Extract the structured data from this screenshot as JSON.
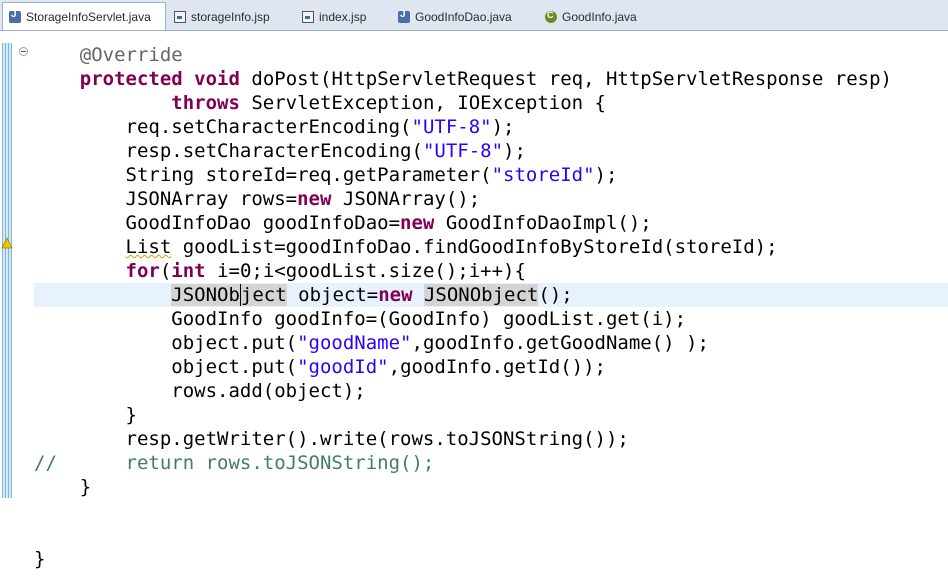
{
  "tabs": [
    {
      "label": "StorageInfoServlet.java",
      "active": true,
      "icon": "java-file-icon"
    },
    {
      "label": "storageInfo.jsp",
      "active": false,
      "icon": "jsp-file-icon"
    },
    {
      "label": "index.jsp",
      "active": false,
      "icon": "jsp-file-icon"
    },
    {
      "label": "GoodInfoDao.java",
      "active": false,
      "icon": "java-file-icon"
    },
    {
      "label": "GoodInfo.java",
      "active": false,
      "icon": "java-class-icon"
    }
  ],
  "colors": {
    "keyword": "#7f0055",
    "string": "#2a00ff",
    "comment": "#3f7f5f",
    "annotation": "#646464",
    "current_line": "#e8f2fe"
  },
  "code": {
    "l01": "    @Override",
    "l02a": "    ",
    "l02b": "protected",
    "l02c": " ",
    "l02d": "void",
    "l02e": " doPost(HttpServletRequest req, HttpServletResponse resp)",
    "l03a": "            ",
    "l03b": "throws",
    "l03c": " ServletException, IOException {",
    "l04a": "        req.setCharacterEncoding(",
    "l04b": "\"UTF-8\"",
    "l04c": ");",
    "l05a": "        resp.setCharacterEncoding(",
    "l05b": "\"UTF-8\"",
    "l05c": ");",
    "l06a": "        String storeId=req.getParameter(",
    "l06b": "\"storeId\"",
    "l06c": ");",
    "l07a": "        JSONArray rows=",
    "l07b": "new",
    "l07c": " JSONArray();",
    "l08a": "        GoodInfoDao goodInfoDao=",
    "l08b": "new",
    "l08c": " GoodInfoDaoImpl();",
    "l09a": "        ",
    "l09b": "List",
    "l09c": " goodList=goodInfoDao.findGoodInfoByStoreId(storeId);",
    "l10a": "        ",
    "l10b": "for",
    "l10c": "(",
    "l10d": "int",
    "l10e": " i=0;i<goodList.size();i++){",
    "l11a": "            ",
    "l11b": "JSONOb",
    "l11c": "ject",
    "l11d": " object=",
    "l11e": "new",
    "l11f": " ",
    "l11g": "JSONObject",
    "l11h": "();",
    "l12": "            GoodInfo goodInfo=(GoodInfo) goodList.get(i);",
    "l13a": "            object.put(",
    "l13b": "\"goodName\"",
    "l13c": ",goodInfo.getGoodName() );",
    "l14a": "            object.put(",
    "l14b": "\"goodId\"",
    "l14c": ",goodInfo.getId());",
    "l15": "            rows.add(object);",
    "l16": "        }",
    "l17": "        resp.getWriter().write(rows.toJSONString());",
    "l18": "//      return rows.toJSONString();",
    "l19": "    }",
    "l20": "",
    "l21": "",
    "l22": "}"
  }
}
